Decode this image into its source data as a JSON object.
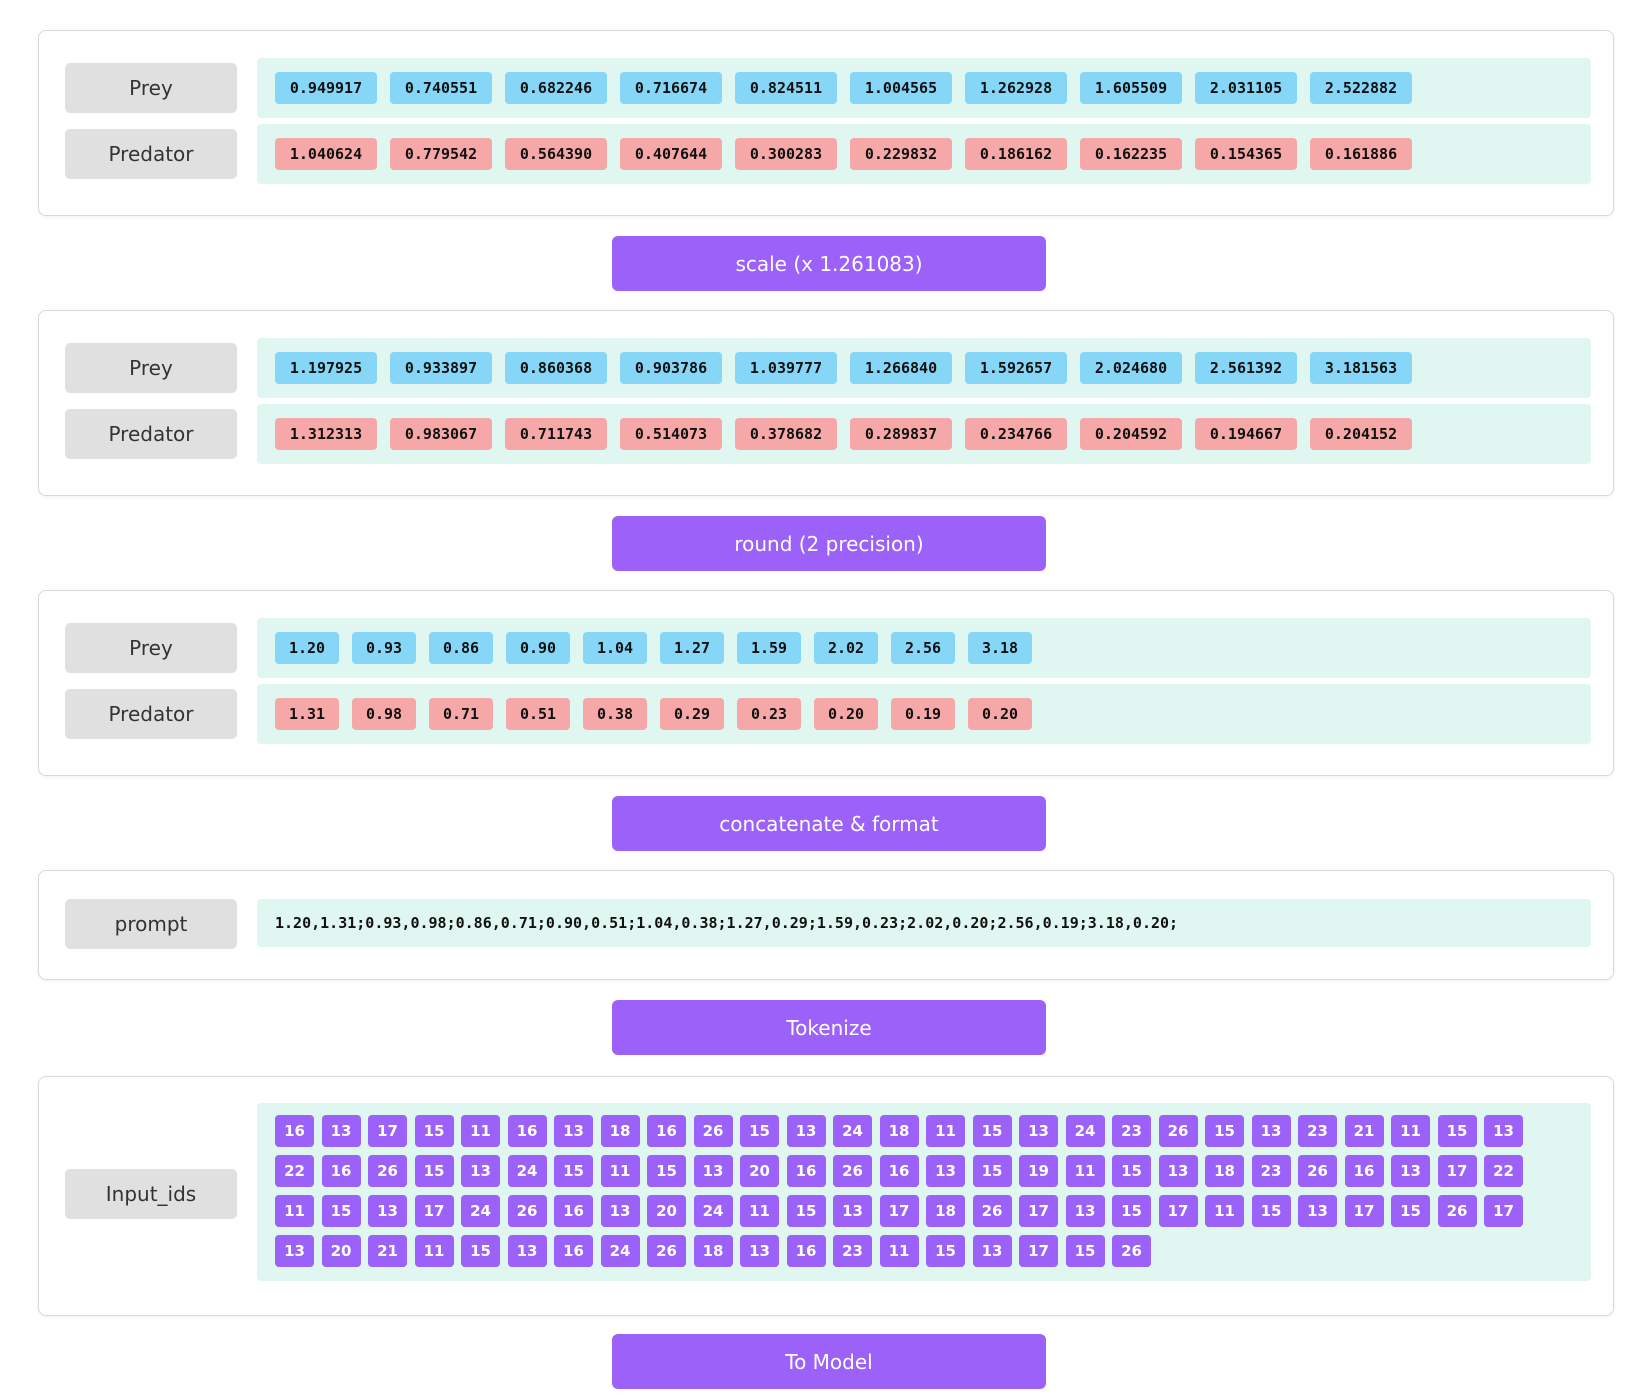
{
  "stages": {
    "raw": {
      "prey_label": "Prey",
      "predator_label": "Predator",
      "prey": [
        "0.949917",
        "0.740551",
        "0.682246",
        "0.716674",
        "0.824511",
        "1.004565",
        "1.262928",
        "1.605509",
        "2.031105",
        "2.522882"
      ],
      "predator": [
        "1.040624",
        "0.779542",
        "0.564390",
        "0.407644",
        "0.300283",
        "0.229832",
        "0.186162",
        "0.162235",
        "0.154365",
        "0.161886"
      ]
    },
    "scaled": {
      "prey_label": "Prey",
      "predator_label": "Predator",
      "prey": [
        "1.197925",
        "0.933897",
        "0.860368",
        "0.903786",
        "1.039777",
        "1.266840",
        "1.592657",
        "2.024680",
        "2.561392",
        "3.181563"
      ],
      "predator": [
        "1.312313",
        "0.983067",
        "0.711743",
        "0.514073",
        "0.378682",
        "0.289837",
        "0.234766",
        "0.204592",
        "0.194667",
        "0.204152"
      ]
    },
    "rounded": {
      "prey_label": "Prey",
      "predator_label": "Predator",
      "prey": [
        "1.20",
        "0.93",
        "0.86",
        "0.90",
        "1.04",
        "1.27",
        "1.59",
        "2.02",
        "2.56",
        "3.18"
      ],
      "predator": [
        "1.31",
        "0.98",
        "0.71",
        "0.51",
        "0.38",
        "0.29",
        "0.23",
        "0.20",
        "0.19",
        "0.20"
      ]
    },
    "prompt": {
      "label": "prompt",
      "text": "1.20,1.31;0.93,0.98;0.86,0.71;0.90,0.51;1.04,0.38;1.27,0.29;1.59,0.23;2.02,0.20;2.56,0.19;3.18,0.20;"
    },
    "tokens": {
      "label": "Input_ids",
      "ids": [
        16,
        13,
        17,
        15,
        11,
        16,
        13,
        18,
        16,
        26,
        15,
        13,
        24,
        18,
        11,
        15,
        13,
        24,
        23,
        26,
        15,
        13,
        23,
        21,
        11,
        15,
        13,
        22,
        16,
        26,
        15,
        13,
        24,
        15,
        11,
        15,
        13,
        20,
        16,
        26,
        16,
        13,
        15,
        19,
        11,
        15,
        13,
        18,
        23,
        26,
        16,
        13,
        17,
        22,
        11,
        15,
        13,
        17,
        24,
        26,
        16,
        13,
        20,
        24,
        11,
        15,
        13,
        17,
        18,
        26,
        17,
        13,
        15,
        17,
        11,
        15,
        13,
        17,
        15,
        26,
        17,
        13,
        20,
        21,
        11,
        15,
        13,
        16,
        24,
        26,
        18,
        13,
        16,
        23,
        11,
        15,
        13,
        17,
        15,
        26
      ]
    }
  },
  "steps": {
    "scale": "scale (x 1.261083)",
    "round": "round (2 precision)",
    "concat": "concatenate & format",
    "tokenize": "Tokenize",
    "model": "To Model"
  },
  "colors": {
    "prey": "#86d6f7",
    "predator": "#f6a8a8",
    "accent": "#9b61f8",
    "row_bg": "#dff7f0",
    "label_bg": "#e0e0e0"
  }
}
